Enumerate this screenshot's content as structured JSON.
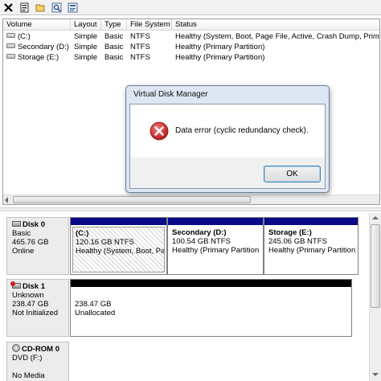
{
  "toolbar": {
    "buttons": [
      "close-icon",
      "properties-icon",
      "open-folder-icon",
      "search-icon",
      "help-icon"
    ]
  },
  "volume_list": {
    "columns": [
      "Volume",
      "Layout",
      "Type",
      "File System",
      "Status"
    ],
    "rows": [
      {
        "volume": "(C:)",
        "layout": "Simple",
        "type": "Basic",
        "fs": "NTFS",
        "status": "Healthy (System, Boot, Page File, Active, Crash Dump, Prima"
      },
      {
        "volume": "Secondary (D:)",
        "layout": "Simple",
        "type": "Basic",
        "fs": "NTFS",
        "status": "Healthy (Primary Partition)"
      },
      {
        "volume": "Storage (E:)",
        "layout": "Simple",
        "type": "Basic",
        "fs": "NTFS",
        "status": "Healthy (Primary Partition)"
      }
    ]
  },
  "dialog": {
    "title": "Virtual Disk Manager",
    "message": "Data error (cyclic redundancy check).",
    "ok_label": "OK"
  },
  "disks": [
    {
      "name": "Disk 0",
      "type": "Basic",
      "size": "465.76 GB",
      "status": "Online",
      "partitions": [
        {
          "name": "(C:)",
          "size": "120.16 GB NTFS",
          "status": "Healthy (System, Boot, Pa"
        },
        {
          "name": "Secondary  (D:)",
          "size": "100.54 GB NTFS",
          "status": "Healthy (Primary Partition"
        },
        {
          "name": "Storage  (E:)",
          "size": "245.06 GB NTFS",
          "status": "Healthy (Primary Partition)"
        }
      ]
    },
    {
      "name": "Disk 1",
      "type": "Unknown",
      "size": "238.47 GB",
      "status": "Not Initialized",
      "partitions": [
        {
          "size": "238.47 GB",
          "status": "Unallocated"
        }
      ]
    },
    {
      "name": "CD-ROM 0",
      "type": "DVD (F:)",
      "status": "No Media"
    }
  ],
  "colors": {
    "primary_partition_bar": "#0b0b8a",
    "unallocated_bar": "#000000",
    "dialog_frame": "#dde6f2",
    "error_icon": "#d32f2f"
  }
}
